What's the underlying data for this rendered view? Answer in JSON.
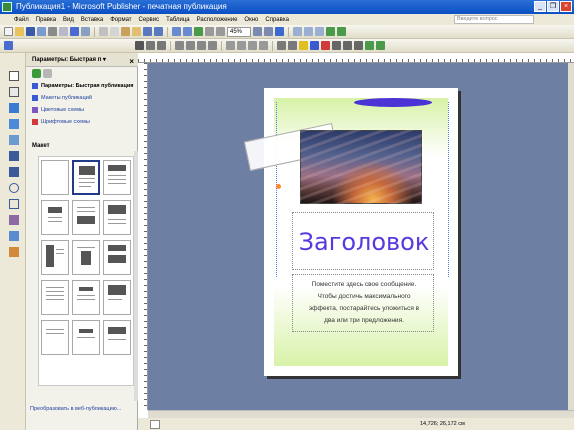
{
  "window": {
    "title": "Публикация1 - Microsoft Publisher - печатная публикация",
    "minimize": "_",
    "restore": "❐",
    "close": "×"
  },
  "menu": {
    "items": [
      "Файл",
      "Правка",
      "Вид",
      "Вставка",
      "Формат",
      "Сервис",
      "Таблица",
      "Расположение",
      "Окно",
      "Справка"
    ],
    "help_placeholder": "Введите вопрос"
  },
  "toolbar": {
    "zoom_value": "45%"
  },
  "task_pane": {
    "title": "Параметры: Быстрая п ▾",
    "close": "×",
    "links": [
      {
        "label": "Параметры: Быстрая публикация",
        "icon": "quick-publication-icon",
        "active": true
      },
      {
        "label": "Макеты публикаций",
        "icon": "publication-designs-icon",
        "active": false
      },
      {
        "label": "Цветовые схемы",
        "icon": "color-schemes-icon",
        "active": false
      },
      {
        "label": "Шрифтовые схемы",
        "icon": "font-schemes-icon",
        "active": false
      }
    ],
    "section_label": "Макет",
    "footer_link": "Преобразовать в веб-публикацию..."
  },
  "publication": {
    "heading": "Заголовок",
    "body_lines": [
      "Поместите здесь свое сообщение.",
      "Чтобы достичь максимального",
      "эффекта, постарайтесь уложиться в",
      "два или три предложения."
    ]
  },
  "status": {
    "coords": "14,726; 26,172 см"
  },
  "colors": {
    "canvas_bg": "#6e7fa4",
    "heading": "#5a38e0",
    "ellipse": "#4a34d6",
    "page_gradient": "#d8f2a8",
    "titlebar": "#0b4fc4"
  }
}
